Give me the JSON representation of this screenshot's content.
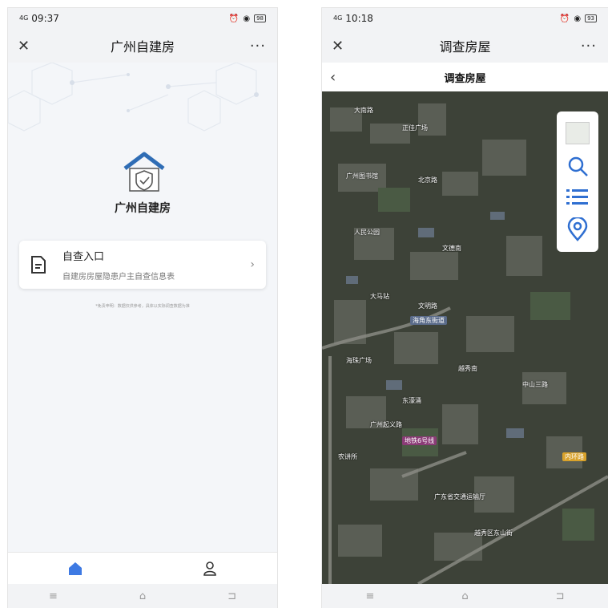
{
  "left_screen": {
    "status": {
      "network": "4G",
      "time": "09:37",
      "battery": "98"
    },
    "title": "广州自建房",
    "close_glyph": "✕",
    "more_glyph": "···",
    "app_name": "广州自建房",
    "entry_card": {
      "title": "自查入口",
      "subtitle": "自建房房屋隐患户主自查信息表",
      "chevron": "›"
    },
    "disclaimer": "*免责申明：数据仅供参考，具体以实际调查数据为准",
    "tabs": [
      {
        "icon": "home-icon",
        "active": true
      },
      {
        "icon": "user-icon",
        "active": false
      }
    ],
    "nav": {
      "menu": "≡",
      "home": "⌂",
      "back": "⊐"
    },
    "accent_color": "#3e7ae3"
  },
  "right_screen": {
    "status": {
      "network": "4G",
      "time": "10:18",
      "battery": "93"
    },
    "title": "调查房屋",
    "close_glyph": "✕",
    "more_glyph": "···",
    "subheader": {
      "back_glyph": "‹",
      "title": "调查房屋"
    },
    "map_tools": [
      "layers-thumbnail",
      "search-icon",
      "list-icon",
      "location-pin-icon"
    ],
    "map_labels": [
      {
        "text": "大南路"
      },
      {
        "text": "正佳广场"
      },
      {
        "text": "广州图书馆"
      },
      {
        "text": "北京路"
      },
      {
        "text": "人民公园"
      },
      {
        "text": "文德南"
      },
      {
        "text": "大马站"
      },
      {
        "text": "文明路"
      },
      {
        "text": "海珠广场"
      },
      {
        "text": "越秀南"
      },
      {
        "text": "东濠涌"
      },
      {
        "text": "中山三路"
      },
      {
        "text": "广东省交通运输厅"
      },
      {
        "text": "越秀区东山街"
      },
      {
        "text": "农讲所"
      },
      {
        "text": "广州起义路"
      }
    ],
    "road_labels": [
      {
        "text": "海角东街道",
        "color": "#5a6b8a"
      },
      {
        "text": "地铁6号线",
        "color": "#8a3b76"
      },
      {
        "text": "内环路",
        "color": "#d9a22b"
      }
    ],
    "nav": {
      "menu": "≡",
      "home": "⌂",
      "back": "⊐"
    },
    "accent_color": "#3e7ae3"
  }
}
